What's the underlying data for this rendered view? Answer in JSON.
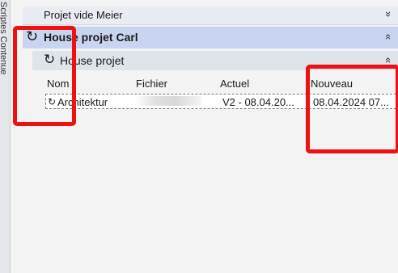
{
  "side_tab": {
    "label": "Scriptes Contenue"
  },
  "tree": {
    "top_row": {
      "label": "Projet vide Meier",
      "chevron": "»"
    },
    "house_row": {
      "label": "House projet Carl",
      "icon": "refresh-icon",
      "chevron": "«"
    },
    "sub_row": {
      "label": "House projet",
      "icon": "refresh-icon",
      "chevron": "«"
    }
  },
  "grid": {
    "columns": [
      "Nom",
      "Fichier",
      "Actuel",
      "Nouveau"
    ],
    "rows": [
      {
        "nom": "Architektur",
        "fichier": "",
        "actuel": "V2 - 08.04.20...",
        "nouveau": "08.04.2024 07..."
      }
    ]
  },
  "colors": {
    "highlight": "#ee1111",
    "selected_row": "#c9d4f0"
  }
}
